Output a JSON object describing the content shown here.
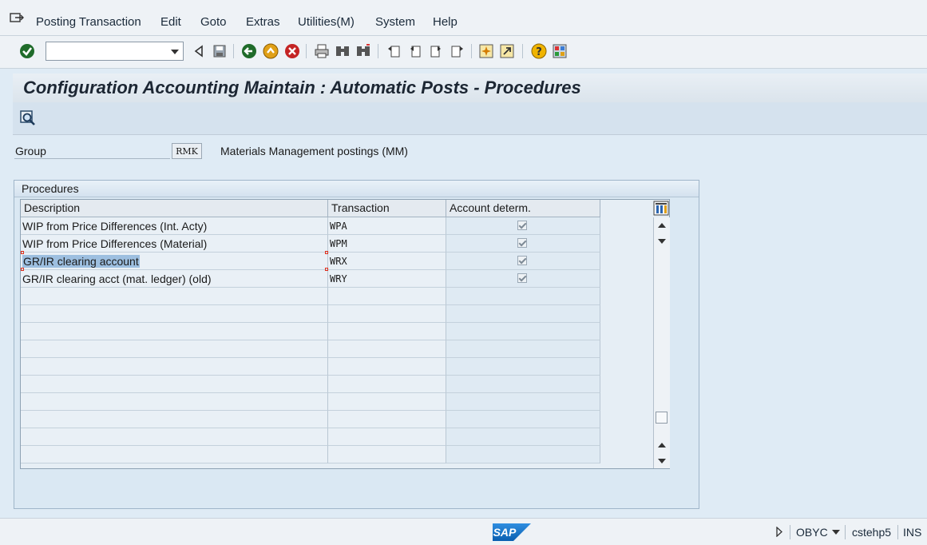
{
  "menubar": {
    "items": [
      "Posting Transaction",
      "Edit",
      "Goto",
      "Extras",
      "Utilities(M)",
      "System",
      "Help"
    ]
  },
  "toolbar": {
    "command_field_value": "",
    "icons": [
      "enter-check-icon",
      "back-triangle-icon",
      "save-icon",
      "back-icon",
      "exit-icon",
      "cancel-icon",
      "print-icon",
      "find-icon",
      "find-next-icon",
      "first-page-icon",
      "previous-page-icon",
      "next-page-icon",
      "last-page-icon",
      "create-session-icon",
      "shortcut-icon",
      "help-icon",
      "customize-layout-icon"
    ]
  },
  "title": "Configuration Accounting Maintain : Automatic Posts - Procedures",
  "group": {
    "label": "Group",
    "value": "RMK",
    "description": "Materials Management postings (MM)"
  },
  "procedures": {
    "title": "Procedures",
    "columns": [
      "Description",
      "Transaction",
      "Account determ."
    ],
    "rows": [
      {
        "description": "WIP from Price Differences (Int. Acty)",
        "transaction": "WPA",
        "account_determ": true
      },
      {
        "description": "WIP from Price Differences (Material)",
        "transaction": "WPM",
        "account_determ": true
      },
      {
        "description": "GR/IR clearing account",
        "transaction": "WRX",
        "account_determ": true,
        "selected": true
      },
      {
        "description": "GR/IR clearing acct (mat. ledger) (old)",
        "transaction": "WRY",
        "account_determ": true
      }
    ],
    "empty_rows": 10
  },
  "status": {
    "logo": "SAP",
    "transaction_code": "OBYC",
    "server": "cstehp5",
    "mode": "INS"
  },
  "colors": {
    "background": "#dfebf5",
    "selection": "#9dbfe0",
    "handle": "#e0301e"
  }
}
